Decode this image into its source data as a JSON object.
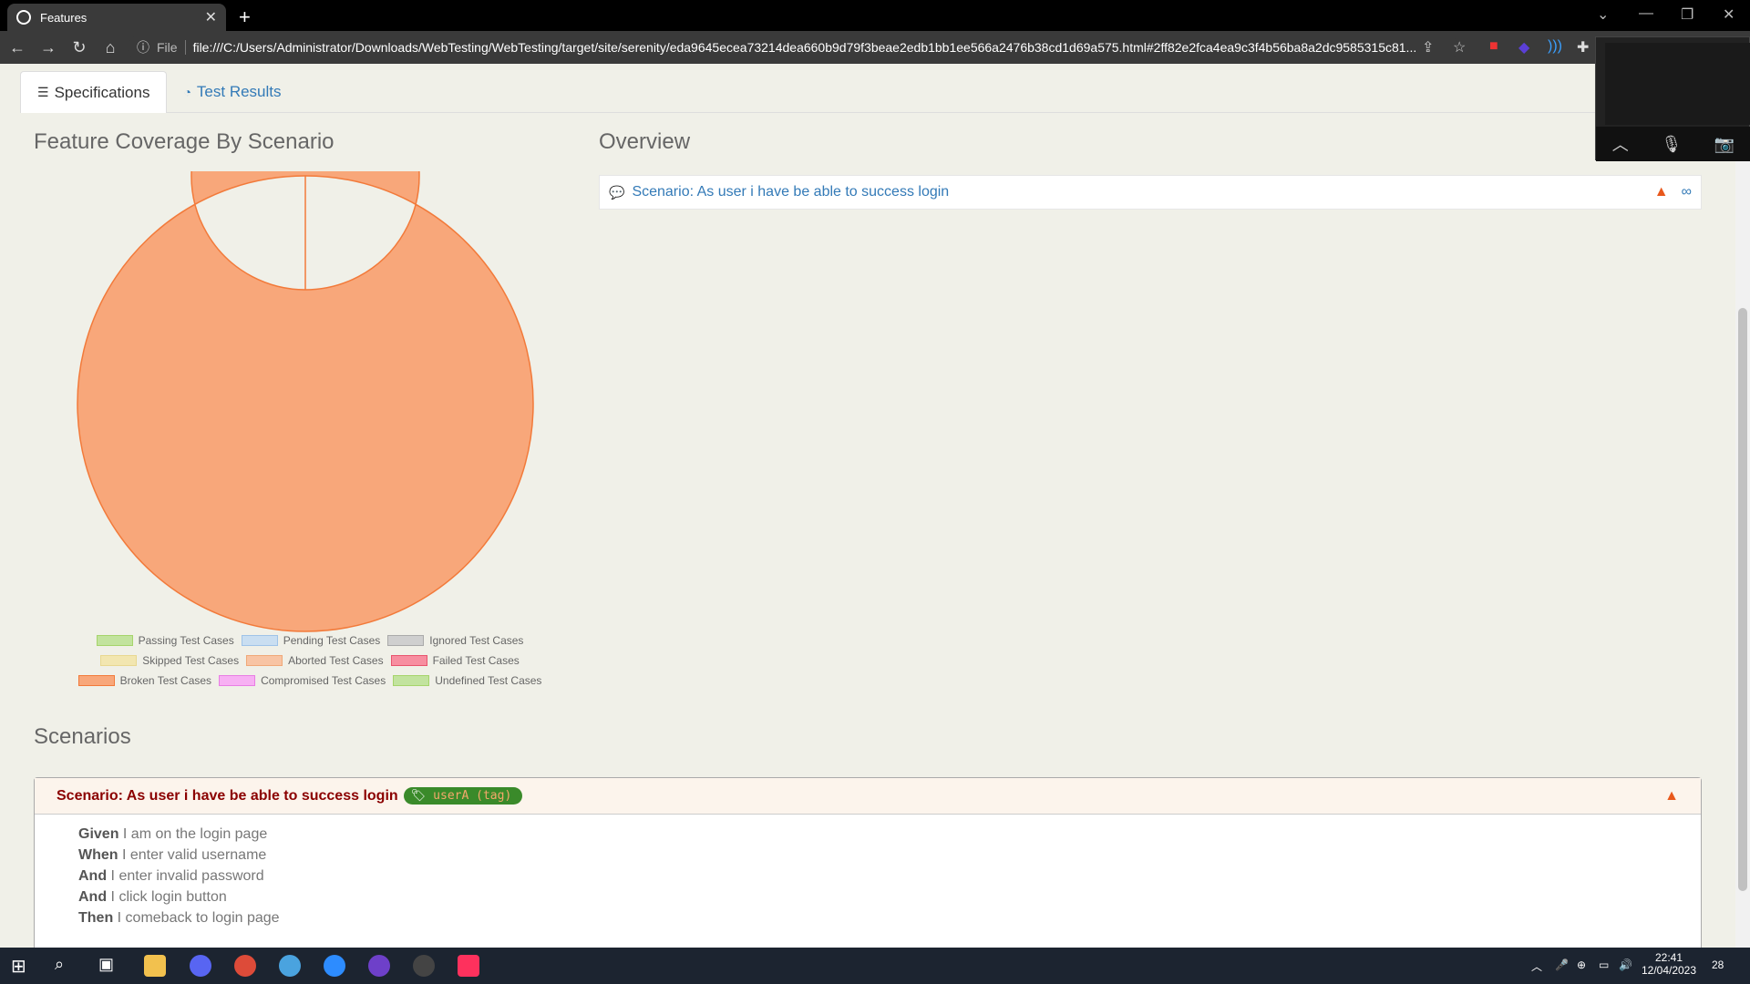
{
  "browser": {
    "tab_title": "Features",
    "file_label": "File",
    "url": "file:///C:/Users/Administrator/Downloads/WebTesting/WebTesting/target/site/serenity/eda9645ecea73214dea660b9d79f3beae2edb1bb1ee566a2476b38cd1d69a575.html#2ff82e2fca4ea9c3f4b56ba8a2dc9585315c81..."
  },
  "page_tabs": {
    "specifications": "Specifications",
    "test_results": "Test Results"
  },
  "coverage": {
    "heading": "Feature Coverage By Scenario"
  },
  "overview": {
    "heading": "Overview",
    "scenario_link": "Scenario: As user i have be able to success login"
  },
  "chart_data": {
    "type": "pie",
    "title": "",
    "donut": true,
    "categories": [
      "Passing Test Cases",
      "Pending Test Cases",
      "Ignored Test Cases",
      "Skipped Test Cases",
      "Aborted Test Cases",
      "Failed Test Cases",
      "Broken Test Cases",
      "Compromised Test Cases",
      "Undefined Test Cases"
    ],
    "values": [
      0,
      0,
      0,
      0,
      0,
      0,
      1,
      0,
      0
    ],
    "colors": [
      "#c2e39e",
      "#c9def1",
      "#cfcfcf",
      "#f2e6b0",
      "#f8c4a4",
      "#f78ea0",
      "#f8a77a",
      "#f7b0f3",
      "#c2e39e"
    ],
    "legend_rows": [
      [
        "Passing Test Cases",
        "Pending Test Cases",
        "Ignored Test Cases"
      ],
      [
        "Skipped Test Cases",
        "Aborted Test Cases",
        "Failed Test Cases"
      ],
      [
        "Broken Test Cases",
        "Compromised Test Cases",
        "Undefined Test Cases"
      ]
    ]
  },
  "scenarios": {
    "heading": "Scenarios",
    "title": "Scenario: As user i have be able to success login",
    "tag": "userA (tag)",
    "steps": [
      {
        "keyword": "Given",
        "text": "I am on the login page"
      },
      {
        "keyword": "When",
        "text": "I enter valid username"
      },
      {
        "keyword": "And",
        "text": "I enter invalid password"
      },
      {
        "keyword": "And",
        "text": "I click login button"
      },
      {
        "keyword": "Then",
        "text": "I comeback to login page"
      }
    ]
  },
  "taskbar": {
    "time": "22:41",
    "date": "12/04/2023",
    "notifications": "28"
  }
}
